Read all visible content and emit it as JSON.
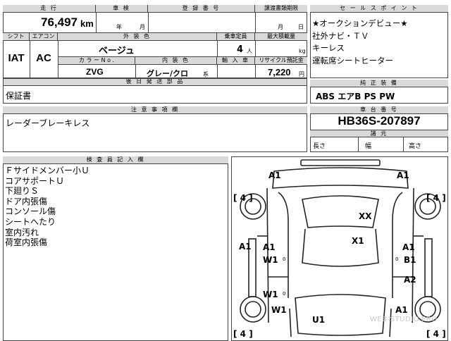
{
  "header": {
    "mileage_label": "走 行",
    "inspection_label": "車 検",
    "registration_label": "登 録 番 号",
    "transfer_label": "譲渡書類期限"
  },
  "vehicle": {
    "mileage": "76,497",
    "mileage_unit": "km",
    "inspection_year_unit": "年",
    "inspection_month_unit": "月",
    "transfer_month_unit": "月",
    "transfer_day_unit": "日",
    "shift_label": "シフト",
    "ac_label": "エアコン",
    "shift": "IAT",
    "ac": "AC",
    "exterior_color_label": "外 装 色",
    "exterior_color": "ベージュ",
    "capacity_label": "乗車定員",
    "capacity": "4",
    "capacity_unit": "人",
    "max_load_label": "最大積載量",
    "max_load_unit": "kg",
    "color_no_label": "カ ラ ー  N o .",
    "color_no": "ZVG",
    "interior_color_label": "内 装 色",
    "interior_color": "グレー/クロ",
    "interior_suffix": "系",
    "import_label": "輸 入 車",
    "recycle_label": "リサイクル預託金",
    "recycle_fee": "7,220",
    "recycle_unit": "円",
    "docs_label": "後 日 発 送 部 品",
    "docs_value": "保証書",
    "notes_label": "注 意 事 項 欄",
    "notes_value": "レーダーブレーキレス"
  },
  "sales": {
    "label": "セ ー ル ス ポ イ ン ト",
    "points": [
      "★オークションデビュー★",
      "社外ナビ・ＴＶ",
      "キーレス",
      "運転席シートヒーター"
    ]
  },
  "equipment": {
    "label": "純 正 装 備",
    "value": "ABS エアB PS PW"
  },
  "chassis": {
    "label": "車 台 番 号",
    "value": "HB36S-207897",
    "dims_label": "諸 元",
    "length_label": "長さ",
    "width_label": "幅",
    "height_label": "高さ"
  },
  "inspector": {
    "label": "検 査 員 記 入 欄",
    "remarks": [
      "Ｆサイドメンバー小Ｕ",
      "コアサポートＵ",
      "下廻りＳ",
      "ドア内張傷",
      "コンソール傷",
      "シートへたり",
      "室内汚れ",
      "荷室内張傷"
    ]
  },
  "diagram": {
    "marks": {
      "front_left": "A1",
      "front_right": "A1",
      "left_wheel_front": "[ 4 ]",
      "right_wheel_front": "[ 4 ]",
      "hood": "XX",
      "roof": "X1",
      "left_side": "A1",
      "left_door_a": "A1",
      "left_door_w": "W1",
      "left_door_w_val": "0",
      "right_door_a": "A1",
      "right_door_b": "B1",
      "right_door_b_val": "0",
      "right_rear_a": "A2",
      "left_rear_w": "W1",
      "left_rear_w_val": "0",
      "left_bottom_w": "W1",
      "rear": "U1",
      "rear_right": "A1",
      "left_wheel_rear": "[ 4 ]",
      "right_wheel_rear": "[ 4 ]"
    },
    "watermark": "WEB-STUDIO.PRO"
  }
}
